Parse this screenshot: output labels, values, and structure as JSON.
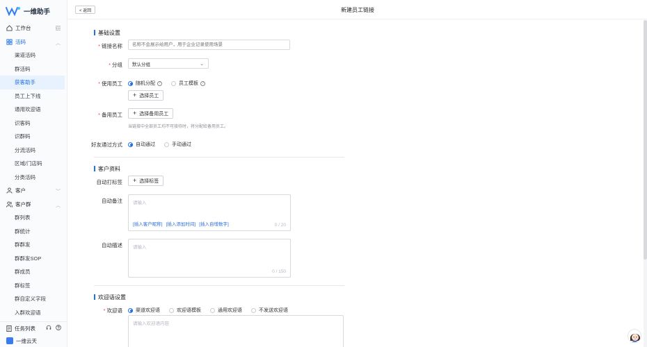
{
  "app": {
    "name": "一维助手",
    "brand_color": "#1e6fe8"
  },
  "sidebar": {
    "groups": [
      {
        "label": "工作台",
        "icon": "home-icon"
      },
      {
        "label": "活码",
        "icon": "grid-icon",
        "items": [
          "渠道活码",
          "群活码",
          "获客助手",
          "员工上下线",
          "通用欢迎语",
          "识客码",
          "识群码",
          "分流活码",
          "区域/门店码",
          "分类活码"
        ]
      },
      {
        "label": "客户",
        "icon": "user-icon"
      },
      {
        "label": "客户群",
        "icon": "users-icon",
        "items": [
          "群列表",
          "群统计",
          "群群发",
          "群群发SOP",
          "群成员",
          "群标签",
          "群自定义字段",
          "入群欢迎语"
        ]
      }
    ],
    "selected_item": "获客助手",
    "bottom": {
      "tasks": "任务列表",
      "org": "一维云天"
    }
  },
  "header": {
    "back_label": "< 返回",
    "title": "新建员工链接"
  },
  "form": {
    "basic": {
      "section": "基础设置",
      "link_name_label": "链接名称",
      "link_name_placeholder": "名称不会展示给用户，用于企业记录使用场景",
      "group_label": "分组",
      "group_value": "默认分组",
      "staff_label": "使用员工",
      "staff_options": [
        "随机分配",
        "员工模板"
      ],
      "staff_selected": "随机分配",
      "select_staff_btn": "选择员工",
      "backup_label": "备用员工",
      "select_backup_btn": "选择备用员工",
      "backup_hint": "当链接中全部员工均不可接待时，将分配给备用员工。",
      "friend_label": "好友通过方式",
      "friend_options": [
        "自动通过",
        "手动通过"
      ],
      "friend_selected": "自动通过"
    },
    "customer": {
      "section": "客户资料",
      "auto_tag_label": "自动打标签",
      "select_tag_btn": "选择标签",
      "auto_remark_label": "自动备注",
      "auto_remark_placeholder": "请输入",
      "inserts": [
        "[插入客户昵称]",
        "[插入添加时间]",
        "[插入自增数字]"
      ],
      "remark_count": "0 / 20",
      "auto_desc_label": "自动描述",
      "auto_desc_placeholder": "请输入",
      "desc_count": "0 / 150"
    },
    "welcome": {
      "section": "欢迎语设置",
      "label": "欢迎语",
      "options": [
        "渠道欢迎语",
        "欢迎语模板",
        "通用欢迎语",
        "不发送欢迎语"
      ],
      "selected": "渠道欢迎语",
      "placeholder": "请输入欢迎语内容"
    }
  }
}
